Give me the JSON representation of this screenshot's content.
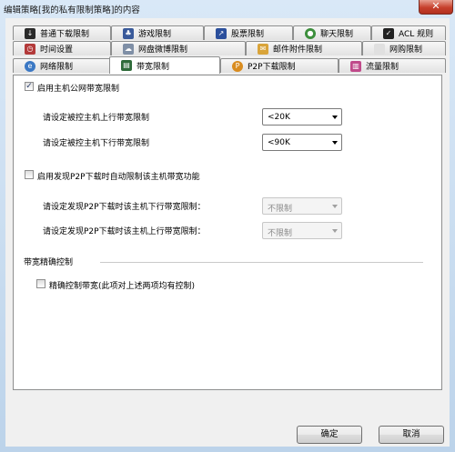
{
  "window": {
    "title": "编辑策略[我的私有限制策略]的内容",
    "close_label": "✕"
  },
  "tabs": {
    "row1": [
      {
        "label": "普通下载限制",
        "icon": "download-icon",
        "color": "#2a2a2a"
      },
      {
        "label": "游戏限制",
        "icon": "game-icon",
        "color": "#3a5a9a"
      },
      {
        "label": "股票限制",
        "icon": "stock-icon",
        "color": "#2b4f9c"
      },
      {
        "label": "聊天限制",
        "icon": "chat-icon",
        "color": "#3c8f3c"
      },
      {
        "label": "ACL 规则",
        "icon": "acl-icon",
        "color": "#222222"
      }
    ],
    "row2": [
      {
        "label": "时间设置",
        "icon": "clock-icon",
        "color": "#b33a3a"
      },
      {
        "label": "网盘微博限制",
        "icon": "cloud-drive-icon",
        "color": "#7f8fa6"
      },
      {
        "label": "邮件附件限制",
        "icon": "mail-icon",
        "color": "#d9a43a"
      },
      {
        "label": "网购限制",
        "icon": "shopping-icon",
        "color": "#e0e0e0"
      }
    ],
    "row3": [
      {
        "label": "网络限制",
        "icon": "network-icon",
        "color": "#3b78c4"
      },
      {
        "label": "带宽限制",
        "icon": "bandwidth-icon",
        "color": "#2f6b3a"
      },
      {
        "label": "P2P下载限制",
        "icon": "p2p-icon",
        "color": "#d98c1f"
      },
      {
        "label": "流量限制",
        "icon": "traffic-icon",
        "color": "#c04a8a"
      }
    ]
  },
  "bandwidth": {
    "enable_label": "启用主机公网带宽限制",
    "enable_checked": true,
    "upload_label": "请设定被控主机上行带宽限制",
    "upload_value": "<20K",
    "download_label": "请设定被控主机下行带宽限制",
    "download_value": "<90K"
  },
  "p2p": {
    "enable_label": "启用发现P2P下载时自动限制该主机带宽功能",
    "enable_checked": false,
    "download_label": "请设定发现P2P下载时该主机下行带宽限制：",
    "download_value": "不限制",
    "upload_label": "请设定发现P2P下载时该主机上行带宽限制：",
    "upload_value": "不限制"
  },
  "precise": {
    "section_label": "带宽精确控制",
    "check_label": "精确控制带宽(此项对上述两项均有控制)",
    "checked": false
  },
  "footer": {
    "ok_label": "确定",
    "cancel_label": "取消"
  }
}
